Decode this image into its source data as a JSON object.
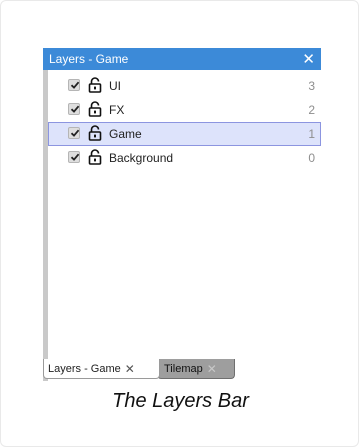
{
  "panel": {
    "title": "Layers - Game",
    "close_glyph": "✕",
    "colors": {
      "titlebar": "#3c8ad8",
      "selected_bg": "#dde3fb",
      "selected_border": "#8c95e0",
      "inactive_tab": "#9e9e9e"
    }
  },
  "layers": [
    {
      "name": "UI",
      "count": "3",
      "checked": true,
      "icon": "lock-open-icon"
    },
    {
      "name": "FX",
      "count": "2",
      "checked": true,
      "icon": "lock-open-icon"
    },
    {
      "name": "Game",
      "count": "1",
      "checked": true,
      "icon": "lock-open-icon",
      "selected": true
    },
    {
      "name": "Background",
      "count": "0",
      "checked": true,
      "icon": "lock-open-icon"
    }
  ],
  "tabs": [
    {
      "label": "Layers - Game",
      "active": true,
      "close": "✕"
    },
    {
      "label": "Tilemap",
      "active": false,
      "close": "✕"
    }
  ],
  "caption": "The Layers Bar"
}
